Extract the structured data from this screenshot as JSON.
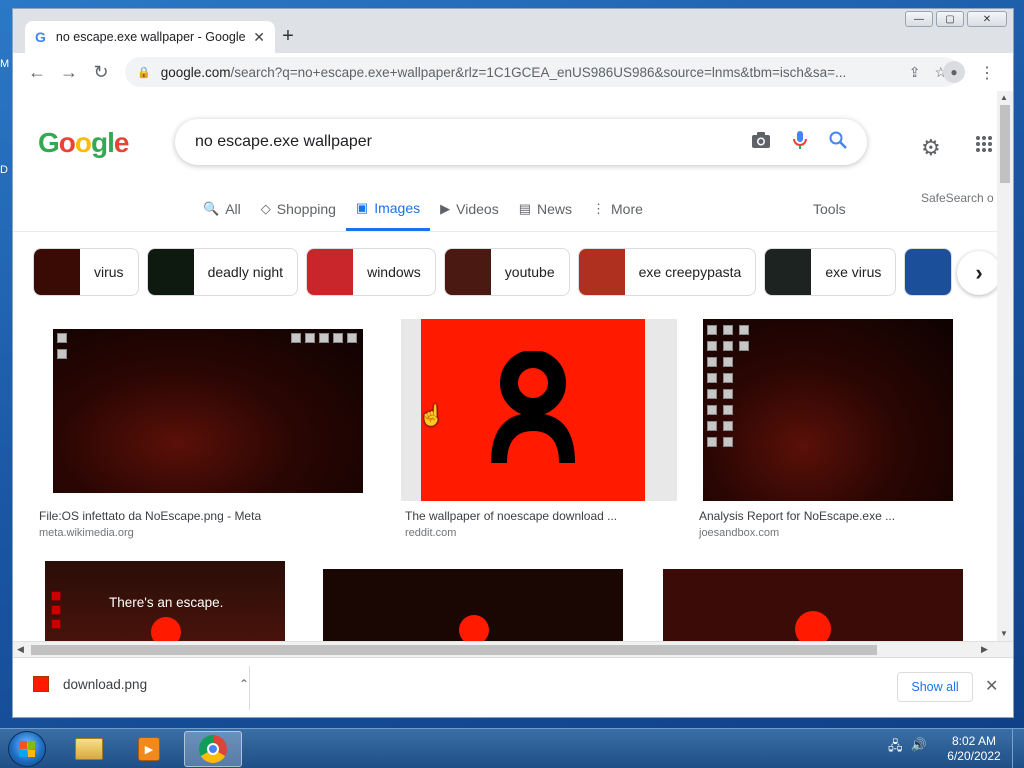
{
  "desktop": {
    "glyph_m": "M",
    "glyph_d": "D"
  },
  "window": {
    "minimize": "—",
    "maximize": "▢",
    "close": "✕"
  },
  "tab": {
    "favicon": "G",
    "title": "no escape.exe wallpaper - Google",
    "close": "✕",
    "new_tab": "+"
  },
  "toolbar": {
    "back": "←",
    "forward": "→",
    "reload": "↻",
    "url_host": "google.com",
    "url_rest": "/search?q=no+escape.exe+wallpaper&rlz=1C1GCEA_enUS986US986&source=lnms&tbm=isch&sa=...",
    "share": "⇪",
    "bookmark": "☆",
    "profile": "●",
    "menu": "⋮"
  },
  "google": {
    "query": "no escape.exe wallpaper",
    "logo": [
      "G",
      "o",
      "o",
      "g",
      "l",
      "e"
    ],
    "settings": "⚙",
    "apps": "⠿⠿⠿"
  },
  "nav": {
    "tabs": [
      {
        "icon": "🔍",
        "label": "All"
      },
      {
        "icon": "◇",
        "label": "Shopping"
      },
      {
        "icon": "▣",
        "label": "Images"
      },
      {
        "icon": "▶",
        "label": "Videos"
      },
      {
        "icon": "▤",
        "label": "News"
      },
      {
        "icon": "⋮",
        "label": "More"
      }
    ],
    "tools": "Tools",
    "safesearch": "SafeSearch o"
  },
  "chips": [
    {
      "label": "virus",
      "color": "#3a0a05"
    },
    {
      "label": "deadly night",
      "color": "#0e1a10"
    },
    {
      "label": "windows",
      "color": "#c8262a"
    },
    {
      "label": "youtube",
      "color": "#4a1a12"
    },
    {
      "label": "exe creepypasta",
      "color": "#b03020"
    },
    {
      "label": "exe virus",
      "color": "#1c2320"
    },
    {
      "label": "",
      "color": "#1b4f9a"
    }
  ],
  "chips_next": "›",
  "results": [
    {
      "caption": "File:OS infettato da NoEscape.png - Meta",
      "source": "meta.wikimedia.org"
    },
    {
      "caption": "The wallpaper of noescape download ...",
      "source": "reddit.com"
    },
    {
      "caption": "Analysis Report for NoEscape.exe ...",
      "source": "joesandbox.com"
    },
    {
      "overlay_text": "There's an escape."
    },
    {},
    {}
  ],
  "downloads": {
    "filename": "download.png",
    "chevron": "⌃",
    "show_all": "Show all",
    "close": "✕"
  },
  "scrollbars": {
    "up": "▲",
    "down": "▼",
    "left": "◀",
    "right": "▶"
  },
  "taskbar": {
    "time": "8:02 AM",
    "date": "6/20/2022",
    "tray_network": "🖧",
    "tray_volume": "🔊",
    "media_glyph": "▶"
  }
}
